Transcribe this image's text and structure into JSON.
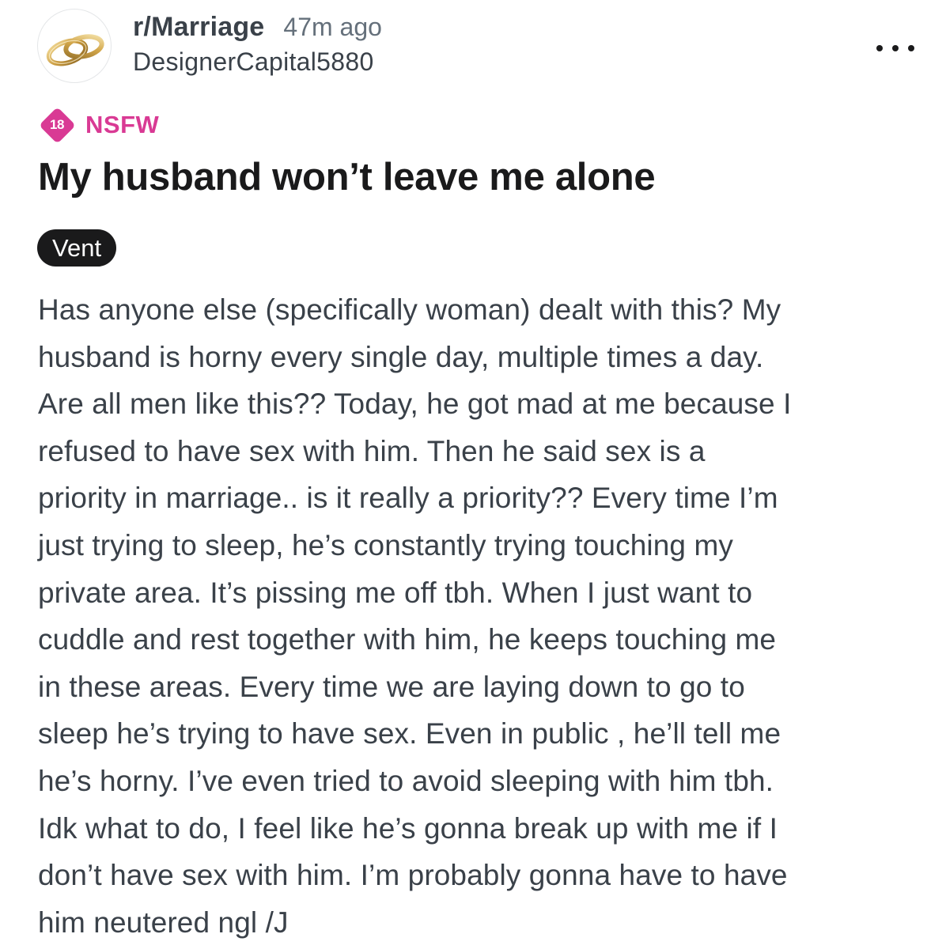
{
  "post": {
    "subreddit": "r/Marriage",
    "time_ago": "47m ago",
    "author": "DesignerCapital5880",
    "avatar_icon": "wedding-rings-icon",
    "more_icon": "more-options-icon",
    "nsfw": {
      "badge_number": "18",
      "label": "NSFW",
      "color": "#d93a94"
    },
    "title": "My husband won’t leave me alone",
    "flair": "Vent",
    "body_lines": [
      "Has anyone else (specifically woman) dealt with this? My",
      "husband is horny every single day, multiple times a day.",
      "Are all men like this?? Today, he got mad at me because I",
      "refused to have sex with him. Then he said sex is a",
      "priority in marriage.. is it really a priority?? Every time I’m",
      "just trying to sleep, he’s constantly trying touching my",
      "private area. It’s pissing me off tbh. When I just want to",
      "cuddle and rest together with him, he keeps touching me",
      "in these areas. Every time we are laying down to go to",
      "sleep he’s trying to have sex. Even in public , he’ll tell me",
      "he’s horny. I’ve even tried to avoid sleeping with him tbh.",
      "Idk what to do, I feel like he’s gonna break up with me if I",
      "don’t have sex with him. I’m probably gonna have to have",
      "him neutered ngl /J"
    ]
  }
}
